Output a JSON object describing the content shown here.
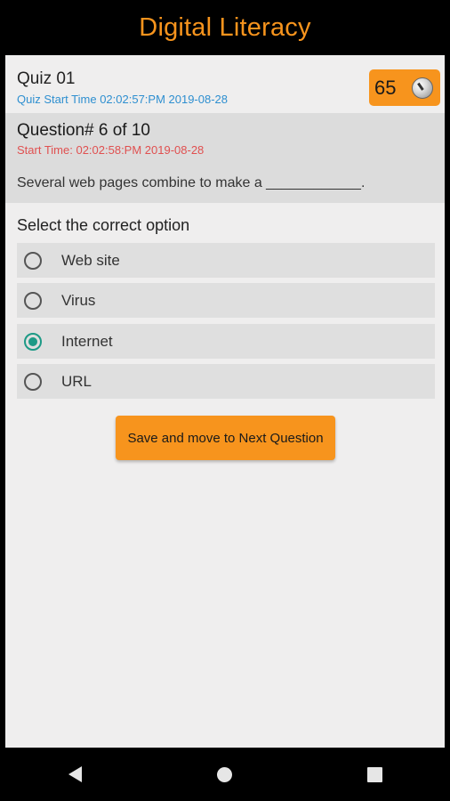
{
  "app": {
    "title": "Digital Literacy"
  },
  "quiz": {
    "title": "Quiz 01",
    "start_time": "Quiz Start Time 02:02:57:PM 2019-08-28",
    "timer_value": "65"
  },
  "question": {
    "number_label": "Question# 6 of 10",
    "start_time": "Start Time: 02:02:58:PM 2019-08-28",
    "text": "Several web pages combine to make a ____________."
  },
  "options_heading": "Select the correct option",
  "options": [
    {
      "label": "Web site",
      "selected": false
    },
    {
      "label": "Virus",
      "selected": false
    },
    {
      "label": "Internet",
      "selected": true
    },
    {
      "label": "URL",
      "selected": false
    }
  ],
  "actions": {
    "next_label": "Save and move to Next Question"
  },
  "colors": {
    "accent": "#f7941d",
    "quiz_time": "#2e8fd0",
    "question_time": "#e05050",
    "radio_selected": "#1d9a86"
  },
  "system_nav": {
    "back_icon": "back-icon",
    "home_icon": "home-icon",
    "recents_icon": "recents-icon"
  }
}
